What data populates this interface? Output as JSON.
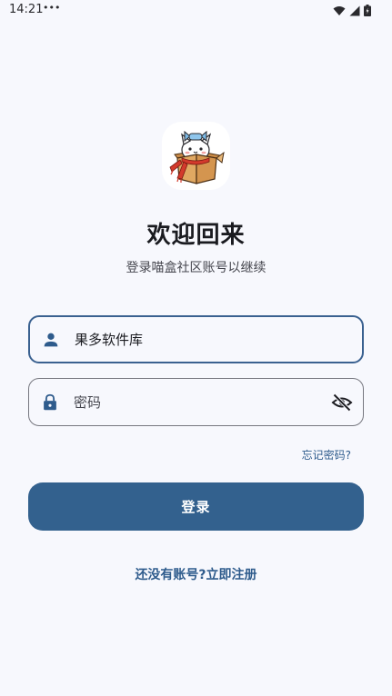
{
  "status_bar": {
    "time": "14:21",
    "notification_dots": "•••",
    "icons": [
      "wifi-icon",
      "signal-icon",
      "battery-icon"
    ]
  },
  "logo": {
    "icon": "cat-in-box-logo"
  },
  "header": {
    "title": "欢迎回来",
    "subtitle": "登录喵盒社区账号以继续"
  },
  "form": {
    "username": {
      "value": "果多软件库",
      "icon": "person-icon"
    },
    "password": {
      "placeholder": "密码",
      "value": "",
      "icon": "lock-icon",
      "toggle_icon": "visibility-off-icon"
    },
    "forgot_label": "忘记密码?",
    "login_label": "登录",
    "register_label": "还没有账号?立即注册"
  },
  "colors": {
    "primary": "#33618e",
    "background": "#f7f8fd",
    "link": "#2e5b8c",
    "text": "#1a1b20"
  }
}
